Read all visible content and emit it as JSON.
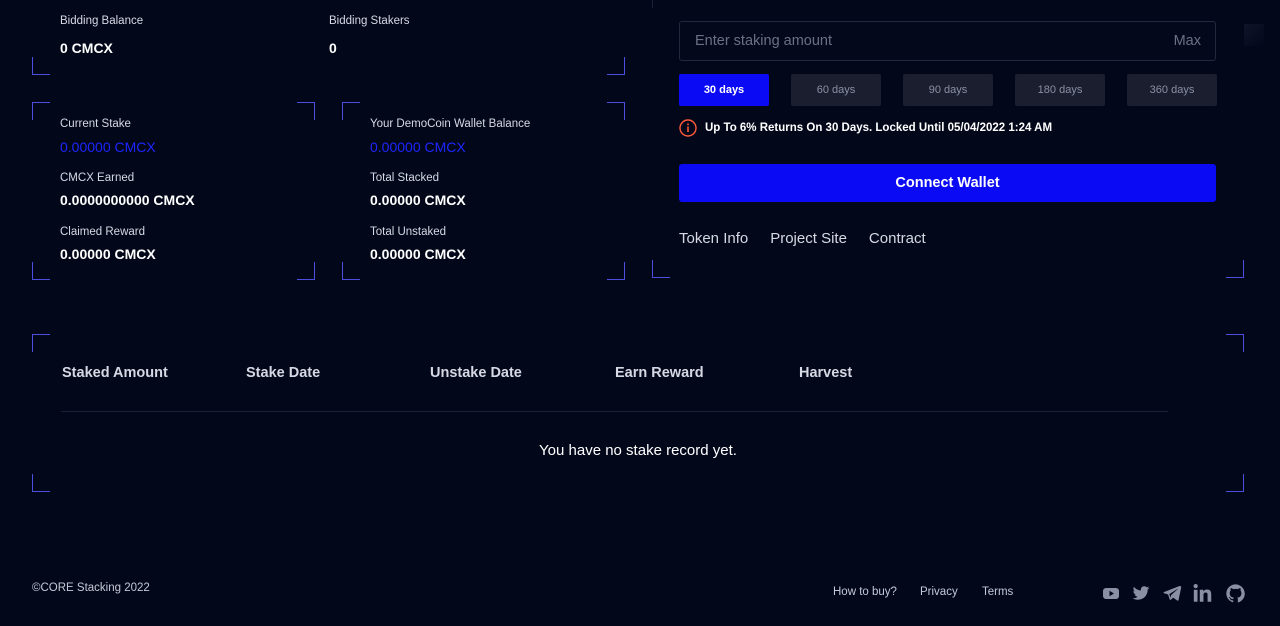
{
  "bidding": {
    "balance_label": "Bidding Balance",
    "balance_value": "0 CMCX",
    "stakers_label": "Bidding Stakers",
    "stakers_value": "0"
  },
  "stats_left": [
    {
      "label": "Current Stake",
      "value": "0.00000 CMCX"
    },
    {
      "label": "CMCX Earned",
      "value": "0.0000000000 CMCX"
    },
    {
      "label": "Claimed Reward",
      "value": "0.00000 CMCX"
    }
  ],
  "stats_right": [
    {
      "label": "Your DemoCoin Wallet Balance",
      "value": "0.00000 CMCX"
    },
    {
      "label": "Total Stacked",
      "value": "0.00000 CMCX"
    },
    {
      "label": "Total Unstaked",
      "value": "0.00000 CMCX"
    }
  ],
  "stake_form": {
    "placeholder": "Enter staking amount",
    "max_label": "Max",
    "durations": [
      "30 days",
      "60 days",
      "90 days",
      "180 days",
      "360 days"
    ],
    "selected_duration": "30 days",
    "info_text": "Up To 6% Returns On 30 Days. Locked Until 05/04/2022 1:24 AM",
    "connect_label": "Connect Wallet"
  },
  "links": [
    "Token Info",
    "Project Site",
    "Contract"
  ],
  "table": {
    "columns": [
      "Staked Amount",
      "Stake Date",
      "Unstake Date",
      "Earn Reward",
      "Harvest"
    ],
    "empty_message": "You have no stake record yet."
  },
  "footer": {
    "copyright": "©CORE Stacking 2022",
    "links": [
      "How to buy?",
      "Privacy",
      "Terms"
    ],
    "social_icons": [
      "youtube-icon",
      "twitter-icon",
      "telegram-icon",
      "linkedin-icon",
      "github-icon"
    ]
  },
  "colors": {
    "background": "#03071a",
    "accent": "#0a0af5",
    "corner": "#4a4fe0",
    "warning": "#ff5a3c"
  }
}
